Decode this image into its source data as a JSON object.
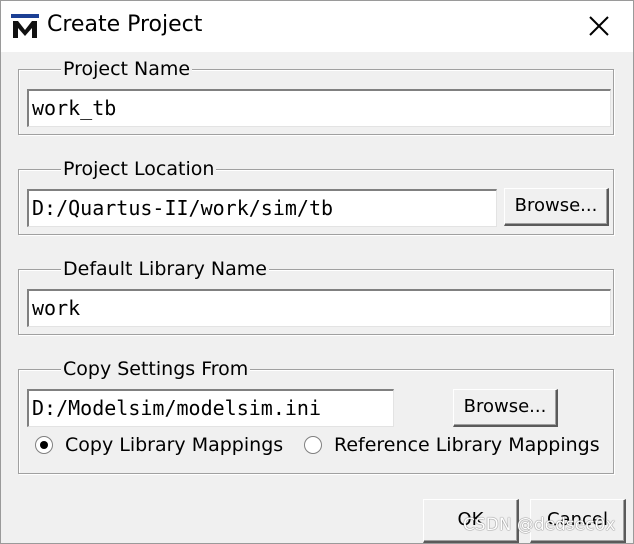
{
  "window": {
    "title": "Create Project",
    "app_icon": "modelsim-m-icon",
    "close_icon": "close-icon"
  },
  "project_name": {
    "label": "Project Name",
    "value": "work_tb"
  },
  "project_location": {
    "label": "Project Location",
    "value": "D:/Quartus-II/work/sim/tb",
    "browse_label": "Browse..."
  },
  "default_library": {
    "label": "Default Library Name",
    "value": "work"
  },
  "copy_settings": {
    "label": "Copy Settings From",
    "value": "D:/Modelsim/modelsim.ini",
    "browse_label": "Browse...",
    "options": [
      {
        "label": "Copy Library Mappings",
        "checked": true
      },
      {
        "label": "Reference Library Mappings",
        "checked": false
      }
    ]
  },
  "footer": {
    "ok_label": "OK",
    "cancel_label": "Cancel",
    "watermark": "CSDN @dedsec0x"
  },
  "colors": {
    "icon_blue": "#1c3f94",
    "icon_dark": "#111111"
  }
}
